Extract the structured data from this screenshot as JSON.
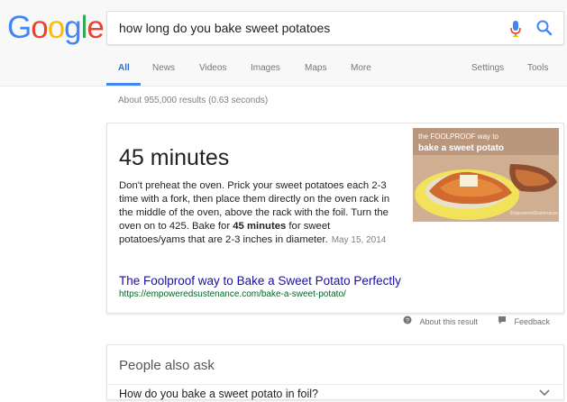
{
  "logo": {
    "letters": [
      "G",
      "o",
      "o",
      "g",
      "l",
      "e"
    ],
    "colors": [
      "#4285f4",
      "#ea4335",
      "#fbbc05",
      "#4285f4",
      "#34a853",
      "#ea4335"
    ]
  },
  "search": {
    "query": "how long do you bake sweet potatoes"
  },
  "tabs": [
    {
      "label": "All"
    },
    {
      "label": "News"
    },
    {
      "label": "Videos"
    },
    {
      "label": "Images"
    },
    {
      "label": "Maps"
    },
    {
      "label": "More"
    }
  ],
  "tools": {
    "settings_label": "Settings",
    "tools_label": "Tools"
  },
  "stats": "About 955,000 results (0.63 seconds)",
  "featured": {
    "answer": "45 minutes",
    "snippet_part1": "Don't preheat the oven. Prick your sweet potatoes each 2-3 time with a fork, then place them directly on the oven rack in the middle of the oven, above the rack with the foil. Turn the oven on to 425. Bake for ",
    "snippet_bold": "45 minutes",
    "snippet_part2": " for sweet potatoes/yams that are 2-3 inches in diameter.",
    "date": "May 15, 2014",
    "thumb_caption_1": "the FOOLPROOF way to",
    "thumb_caption_2": "bake a sweet potato",
    "thumb_watermark": "EmpoweredSustenance",
    "source_title": "The Foolproof way to Bake a Sweet Potato Perfectly",
    "source_url": "https://empoweredsustenance.com/bake-a-sweet-potato/"
  },
  "result_tools": {
    "about": "About this result",
    "feedback": "Feedback"
  },
  "people_also_ask": {
    "title": "People also ask",
    "questions": [
      "How do you bake a sweet potato in foil?"
    ]
  },
  "colors": {
    "accent": "#4285f4",
    "link": "#1a0dab",
    "url": "#006621",
    "mic_red": "#ea4335"
  }
}
